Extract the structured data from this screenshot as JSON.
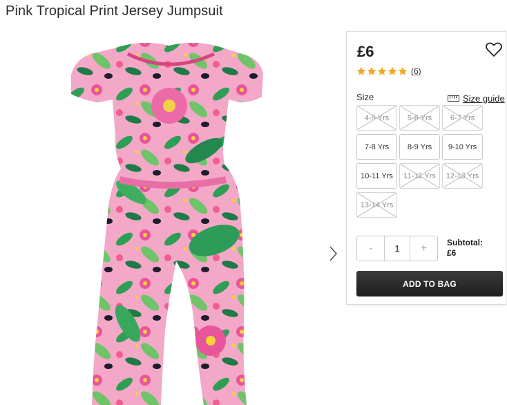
{
  "product": {
    "title": "Pink Tropical Print Jersey Jumpsuit"
  },
  "gallery": {
    "image_icon": "product-photo-jumpsuit",
    "next_icon": "chevron-right-icon"
  },
  "buy_panel": {
    "price": "£6",
    "wishlist_icon": "heart-icon",
    "rating": {
      "stars": 5,
      "max": 5,
      "count": "(6)",
      "star_color": "#f5a623"
    },
    "size_label": "Size",
    "size_guide": "Size guide",
    "sizes": [
      {
        "label": "4-5 Yrs",
        "available": false
      },
      {
        "label": "5-6 Yrs",
        "available": false
      },
      {
        "label": "6-7 Yrs",
        "available": false
      },
      {
        "label": "7-8 Yrs",
        "available": true
      },
      {
        "label": "8-9 Yrs",
        "available": true
      },
      {
        "label": "9-10 Yrs",
        "available": true
      },
      {
        "label": "10-11 Yrs",
        "available": true
      },
      {
        "label": "11-12 Yrs",
        "available": false
      },
      {
        "label": "12-13 Yrs",
        "available": false
      },
      {
        "label": "13-14 Yrs",
        "available": false
      }
    ],
    "quantity": {
      "minus": "-",
      "value": "1",
      "plus": "+"
    },
    "subtotal_label": "Subtotal:",
    "subtotal_value": "£6",
    "add_to_bag": "ADD TO BAG"
  }
}
